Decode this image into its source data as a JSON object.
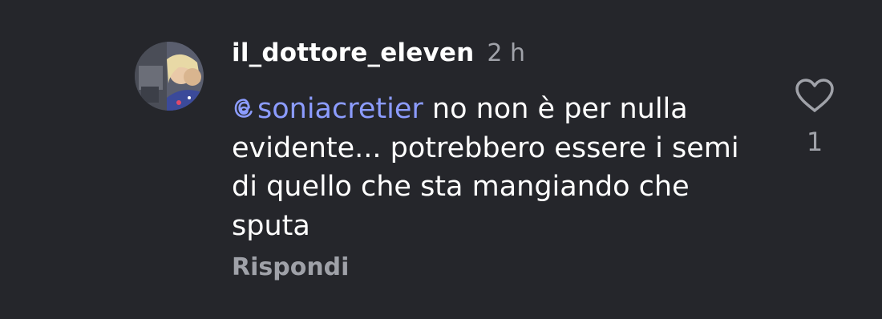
{
  "comment": {
    "username": "il_dottore_eleven",
    "timestamp": "2 h",
    "mention": "soniacretier",
    "text_after_mention": " no non è per nulla evidente... potrebbero essere i semi di quello che sta mangiando che sputa",
    "reply_label": "Rispondi",
    "like_count": "1"
  },
  "icons": {
    "like": "heart-outline-icon",
    "mention": "threads-at-icon"
  },
  "colors": {
    "background": "#25262b",
    "mention": "#8c9cff",
    "muted": "#a0a2a9"
  }
}
